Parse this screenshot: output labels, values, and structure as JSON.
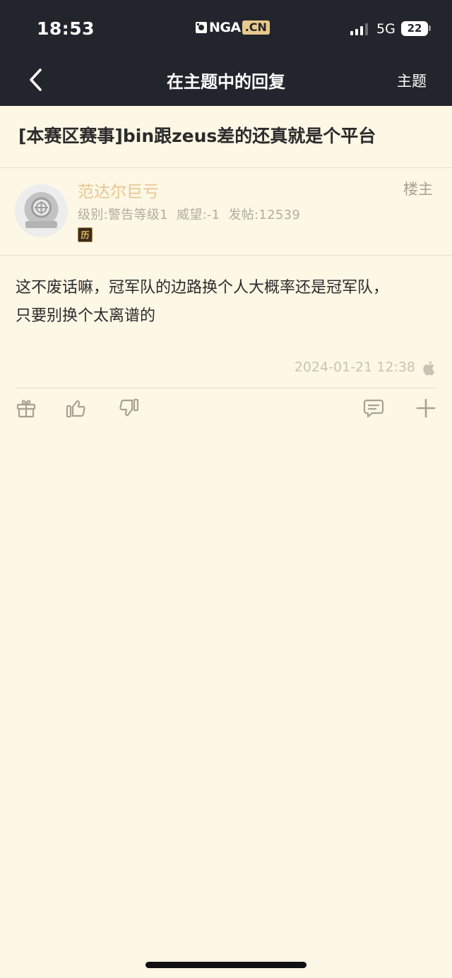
{
  "status_bar": {
    "time": "18:53",
    "logo_text": "NGA",
    "logo_domain": ".CN",
    "network": "5G",
    "battery": "22"
  },
  "nav": {
    "title": "在主题中的回复",
    "right_label": "主题"
  },
  "thread": {
    "title": "[本赛区赛事]bin跟zeus差的还真就是个平台"
  },
  "post": {
    "author": {
      "name": "范达尔巨亏",
      "level": "级别:警告等级1",
      "prestige": "威望:-1",
      "posts": "发帖:12539",
      "badge_char": "历"
    },
    "floor_label": "楼主",
    "content_line1": "这不废话嘛，冠军队的边路换个人大概率还是冠军队，",
    "content_line2": "只要别换个太离谱的",
    "timestamp": "2024-01-21 12:38",
    "device_icon": "apple-icon"
  },
  "actions": [
    "gift-icon",
    "thumbs-up-icon",
    "thumbs-down-icon",
    "comment-icon",
    "plus-icon"
  ],
  "colors": {
    "background": "#fdf7e5",
    "header": "#22252c",
    "username": "#e8c690",
    "meta": "#b3ad9f"
  }
}
